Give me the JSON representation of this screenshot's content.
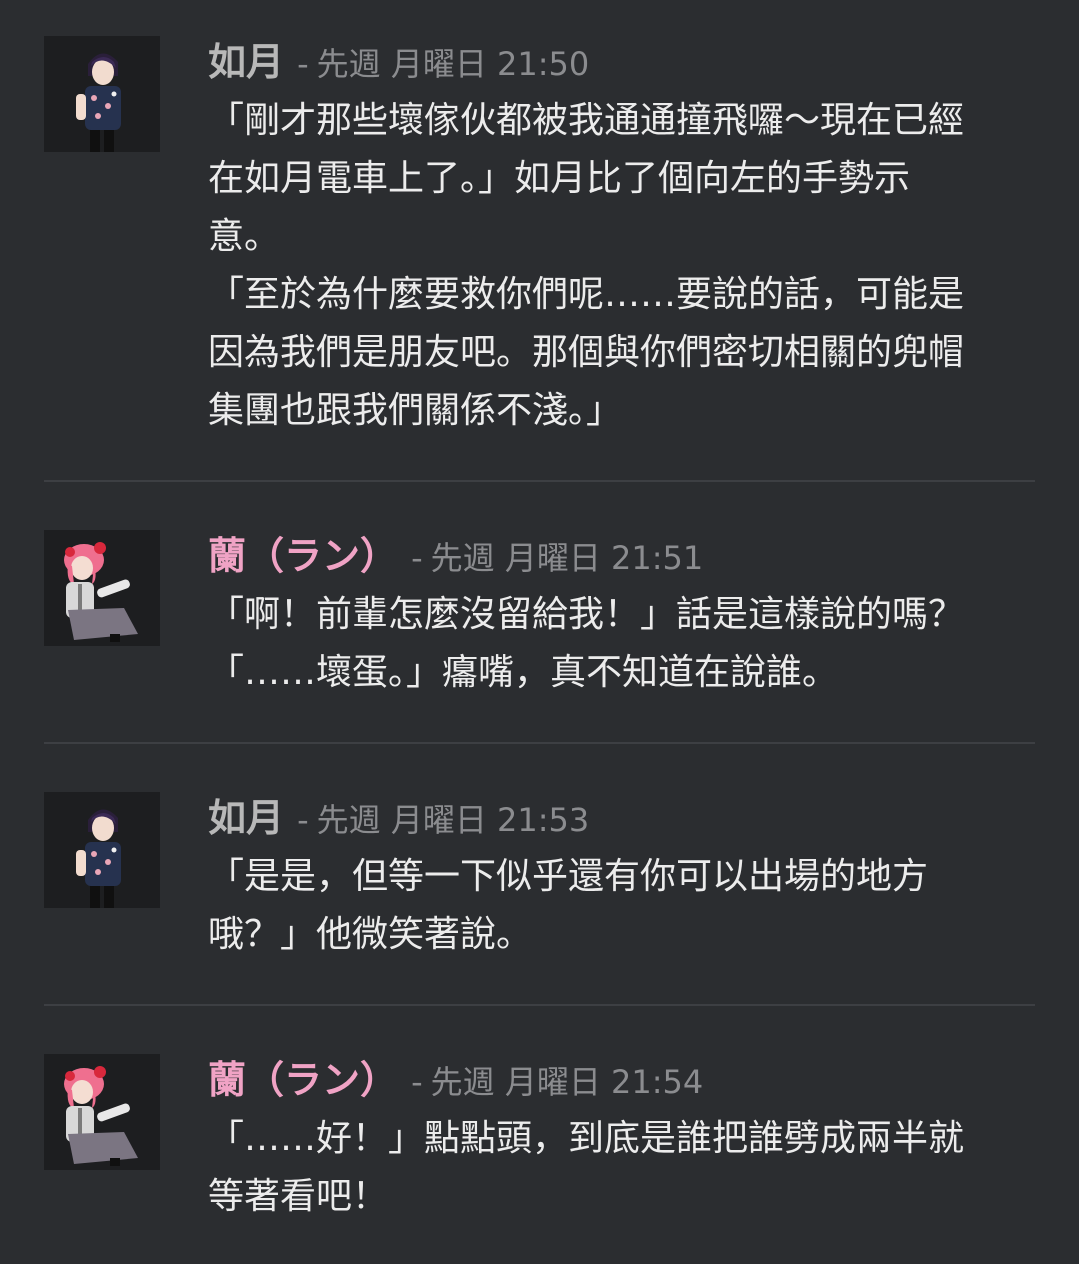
{
  "colors": {
    "background": "#2b2d30",
    "author_default": "#b8b8b8",
    "author_pink": "#f0a3c5",
    "meta": "#8b8c8f",
    "text": "#ececec",
    "divider": "#3d3f43"
  },
  "messages": [
    {
      "author": "如月",
      "author_color": "#b8b8b8",
      "avatar": "kisaragi-avatar",
      "dash": "-",
      "timestamp": "先週 月曜日 21:50",
      "lines": [
        "「剛才那些壞傢伙都被我通通撞飛囉～現在已經",
        "在如月電車上了。」如月比了個向左的手勢示",
        "意。",
        "「至於為什麼要救你們呢……要說的話，可能是",
        "因為我們是朋友吧。那個與你們密切相關的兜帽",
        "集團也跟我們關係不淺。」"
      ]
    },
    {
      "author": "蘭（ラン）",
      "author_color": "#f0a3c5",
      "avatar": "ran-avatar",
      "dash": "-",
      "timestamp": "先週 月曜日 21:51",
      "lines": [
        "「啊！前輩怎麼沒留給我！」話是這樣說的嗎？",
        "「……壞蛋。」癟嘴，真不知道在說誰。"
      ]
    },
    {
      "author": "如月",
      "author_color": "#b8b8b8",
      "avatar": "kisaragi-avatar",
      "dash": "-",
      "timestamp": "先週 月曜日 21:53",
      "lines": [
        "「是是，但等一下似乎還有你可以出場的地方",
        "哦？」他微笑著說。"
      ]
    },
    {
      "author": "蘭（ラン）",
      "author_color": "#f0a3c5",
      "avatar": "ran-avatar",
      "dash": "-",
      "timestamp": "先週 月曜日 21:54",
      "lines": [
        "「……好！」點點頭，到底是誰把誰劈成兩半就",
        "等著看吧！"
      ]
    }
  ]
}
